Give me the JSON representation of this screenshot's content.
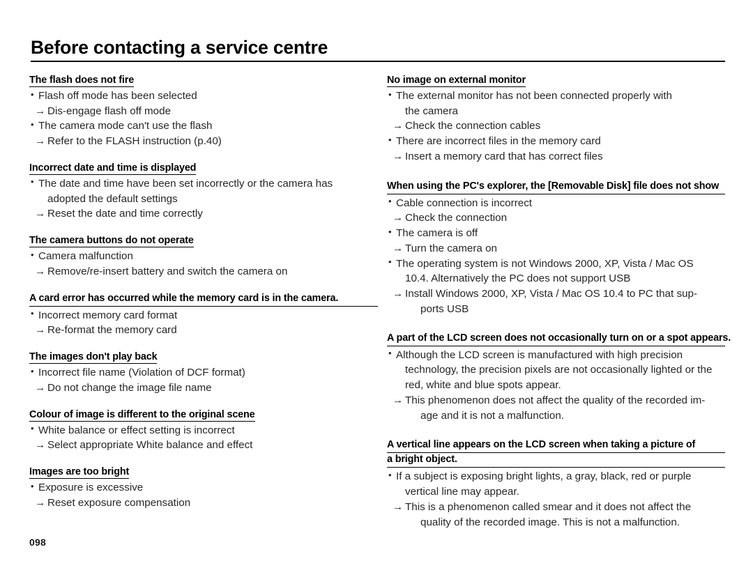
{
  "document": {
    "title": "Before contacting a service centre",
    "page_number": "098"
  },
  "left_column": {
    "sections": [
      {
        "heading": "The flash does not fire",
        "lines": [
          {
            "type": "bullet",
            "text": "Flash off mode has been selected"
          },
          {
            "type": "arrow",
            "text": "Dis-engage flash off mode"
          },
          {
            "type": "bullet",
            "text": "The camera mode can't use the flash"
          },
          {
            "type": "arrow",
            "text": "Refer to the FLASH instruction (p.40)"
          }
        ]
      },
      {
        "heading": "Incorrect date and time is displayed",
        "lines": [
          {
            "type": "bullet",
            "text": "The date and time have been set incorrectly or the camera has"
          },
          {
            "type": "cont",
            "text": "adopted the default settings"
          },
          {
            "type": "arrow",
            "text": "Reset the date and time correctly"
          }
        ]
      },
      {
        "heading": "The camera buttons do not operate",
        "lines": [
          {
            "type": "bullet",
            "text": "Camera malfunction"
          },
          {
            "type": "arrow",
            "text": "Remove/re-insert battery and switch the camera on"
          }
        ]
      },
      {
        "heading": "A card error has occurred while the memory card is in the camera.",
        "lines": [
          {
            "type": "bullet",
            "text": "Incorrect memory card format"
          },
          {
            "type": "arrow",
            "text": "Re-format the memory card"
          }
        ]
      },
      {
        "heading": "The images don't play back",
        "lines": [
          {
            "type": "bullet",
            "text": "Incorrect file name (Violation of DCF format)"
          },
          {
            "type": "arrow",
            "text": "Do not change the image file name"
          }
        ]
      },
      {
        "heading": "Colour of image is different to the original scene",
        "lines": [
          {
            "type": "bullet",
            "text": "White balance or effect setting is incorrect"
          },
          {
            "type": "arrow",
            "text": "Select appropriate White balance and effect"
          }
        ]
      },
      {
        "heading": "Images are too bright",
        "lines": [
          {
            "type": "bullet",
            "text": "Exposure is excessive"
          },
          {
            "type": "arrow",
            "text": "Reset exposure compensation"
          }
        ]
      }
    ]
  },
  "right_column": {
    "sections": [
      {
        "heading": "No image on external monitor",
        "lines": [
          {
            "type": "bullet",
            "text": "The external monitor has not been connected properly with"
          },
          {
            "type": "cont",
            "text": "the camera"
          },
          {
            "type": "arrow",
            "text": "Check the connection cables"
          },
          {
            "type": "bullet",
            "text": "There are incorrect files in the memory card"
          },
          {
            "type": "arrow",
            "text": "Insert a memory card that has correct files"
          }
        ]
      },
      {
        "heading": "When using the PC's explorer, the [Removable Disk] file does not show",
        "lines": [
          {
            "type": "bullet",
            "text": "Cable connection is incorrect"
          },
          {
            "type": "arrow",
            "text": "Check the connection"
          },
          {
            "type": "bullet",
            "text": "The camera is off"
          },
          {
            "type": "arrow",
            "text": "Turn the camera on"
          },
          {
            "type": "bullet",
            "text": "The operating system is not Windows 2000, XP, Vista / Mac OS"
          },
          {
            "type": "cont",
            "text": "10.4. Alternatively the PC does not support USB"
          },
          {
            "type": "arrow",
            "text": "Install Windows 2000, XP, Vista / Mac OS 10.4 to PC that sup-"
          },
          {
            "type": "cont2",
            "text": "ports USB"
          }
        ]
      },
      {
        "heading": "A part of the LCD screen does not occasionally turn on or a spot appears.",
        "lines": [
          {
            "type": "bullet",
            "text": "Although the LCD screen is manufactured with high precision"
          },
          {
            "type": "cont",
            "text": "technology, the precision pixels are not occasionally lighted or the"
          },
          {
            "type": "cont",
            "text": "red, white and blue spots appear."
          },
          {
            "type": "arrow",
            "text": "This phenomenon does not affect the quality of the recorded im-"
          },
          {
            "type": "cont2",
            "text": "age and it is not a malfunction."
          }
        ]
      },
      {
        "heading_lines": [
          "A vertical line appears on the LCD screen when taking a picture of",
          "a bright object."
        ],
        "lines": [
          {
            "type": "bullet",
            "text": "If a subject is exposing bright lights, a gray, black, red or purple"
          },
          {
            "type": "cont",
            "text": "vertical line may appear."
          },
          {
            "type": "arrow",
            "text": "This is a phenomenon called smear and it does not affect the"
          },
          {
            "type": "cont2",
            "text": "quality of the recorded image. This is not a malfunction."
          }
        ]
      }
    ]
  }
}
